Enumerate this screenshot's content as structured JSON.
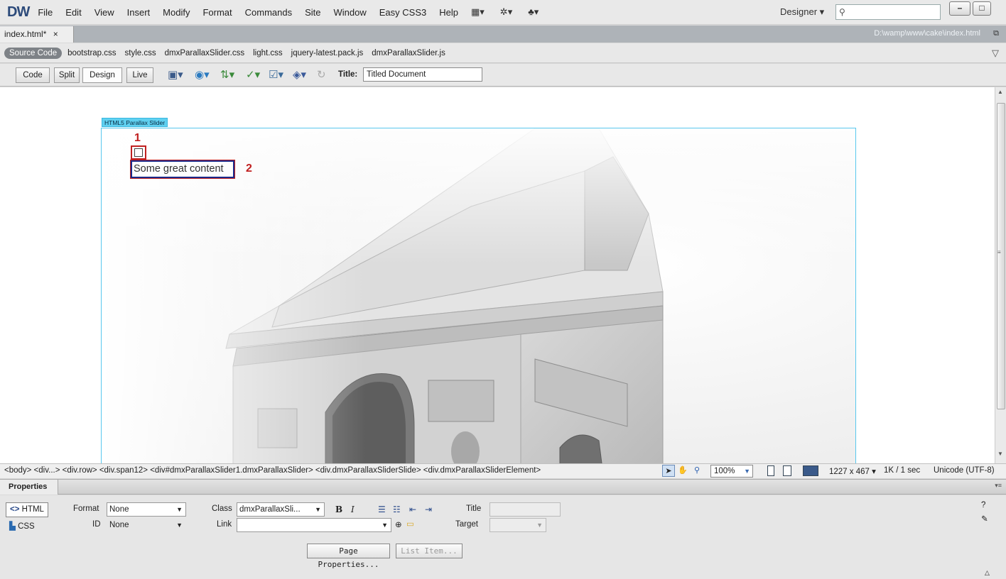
{
  "app": {
    "logo": "DW",
    "menu": [
      "File",
      "Edit",
      "View",
      "Insert",
      "Modify",
      "Format",
      "Commands",
      "Site",
      "Window",
      "Easy CSS3",
      "Help"
    ],
    "workspace": "Designer ▾",
    "search_placeholder": "",
    "window_controls": {
      "minimize": "–",
      "maximize": "□"
    }
  },
  "document": {
    "tab_label": "index.html*",
    "tab_close": "×",
    "path": "D:\\wamp\\www\\cake\\index.html",
    "related_files": {
      "source_code": "Source Code",
      "files": [
        "bootstrap.css",
        "style.css",
        "dmxParallaxSlider.css",
        "light.css",
        "jquery-latest.pack.js",
        "dmxParallaxSlider.js"
      ]
    },
    "toolbar": {
      "views": [
        "Code",
        "Split",
        "Design",
        "Live"
      ],
      "active_view": "Design",
      "title_label": "Title:",
      "title_value": "Titled Document"
    }
  },
  "canvas": {
    "slider_label": "HTML5 Parallax Slider",
    "marker_1": "1",
    "marker_2": "2",
    "content_text": "Some great content",
    "annotation_color": "#c02020",
    "selection_color": "#1b2a8a",
    "slider_border_color": "#58c8ee"
  },
  "status_bar": {
    "tag_path": "<body> <div...> <div.row> <div.span12> <div#dmxParallaxSlider1.dmxParallaxSlider> <div.dmxParallaxSliderSlide> <div.dmxParallaxSliderElement>",
    "zoom": "100%",
    "window_size": "1227 x 467 ▾",
    "download_stats": "1K / 1 sec",
    "encoding": "Unicode (UTF-8)"
  },
  "properties": {
    "title": "Properties",
    "html_btn": "HTML",
    "css_btn": "CSS",
    "format_label": "Format",
    "format_value": "None",
    "id_label": "ID",
    "id_value": "None",
    "class_label": "Class",
    "class_value": "dmxParallaxSli...",
    "link_label": "Link",
    "link_value": "",
    "title_label": "Title",
    "target_label": "Target",
    "bold": "B",
    "italic": "I",
    "page_properties": "Page Properties...",
    "list_item": "List Item..."
  }
}
